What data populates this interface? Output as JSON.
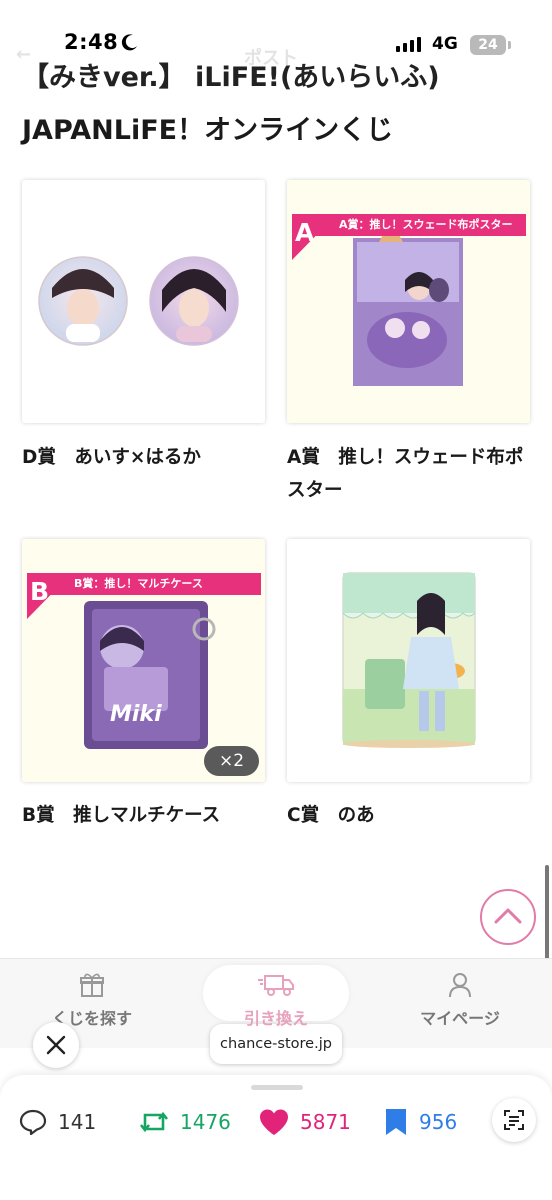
{
  "status": {
    "time": "2:48",
    "network": "4G",
    "battery": "24",
    "nav_faded_title": "ポスト"
  },
  "heading": {
    "line1": "【みきver.】 iLiFE!(あいらいふ)",
    "line2": "JAPANLiFE！オンラインくじ"
  },
  "cards": [
    {
      "label": "D賞　あいす×はるか",
      "image": "badges-photo"
    },
    {
      "label": "A賞　推し！スウェード布ポスター",
      "image": "poster-photo",
      "banner": "A賞：推し！スウェード布ポスター",
      "letter": "A"
    },
    {
      "label": "B賞　推しマルチケース",
      "image": "multicase-photo",
      "banner": "B賞：推し！マルチケース",
      "letter": "B",
      "quantity": "×2"
    },
    {
      "label": "C賞　のあ",
      "image": "acrylic-stand-photo"
    }
  ],
  "tabs": [
    {
      "label": "くじを探す",
      "icon": "gift-icon"
    },
    {
      "label": "引き換え",
      "icon": "truck-icon",
      "active": true
    },
    {
      "label": "マイページ",
      "icon": "person-icon"
    }
  ],
  "browser": {
    "domain": "chance-store.jp"
  },
  "actions": {
    "replies": "141",
    "reposts": "1476",
    "likes": "5871",
    "bookmarks": "956"
  },
  "colors": {
    "accent_pink": "#e8317c",
    "repost_green": "#17a564",
    "like_pink": "#e2237a",
    "bookmark_blue": "#2f7ee8",
    "tab_active": "#e7a1bd"
  }
}
